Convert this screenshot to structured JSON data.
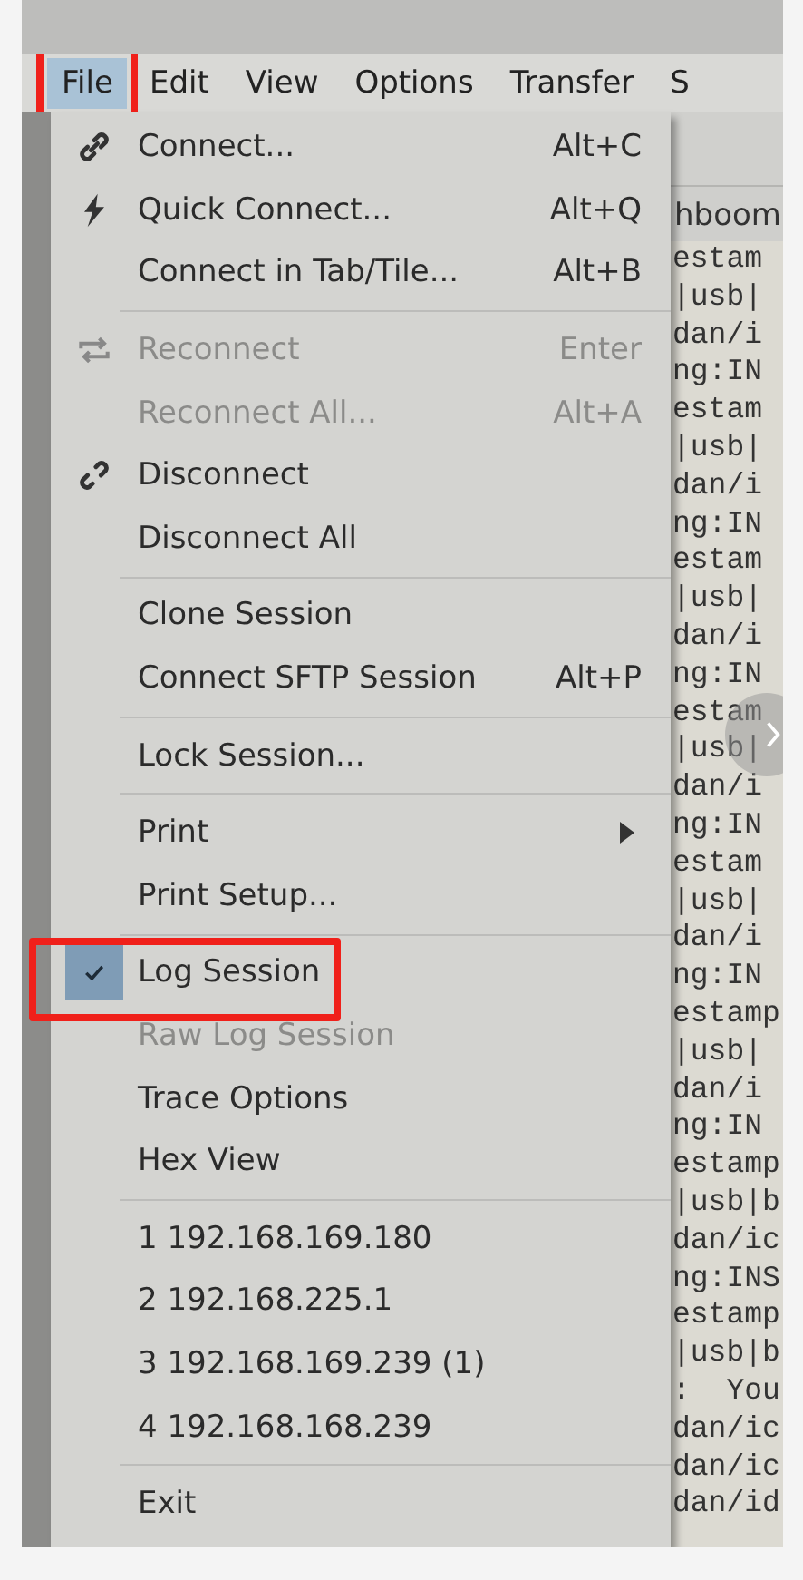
{
  "menubar": [
    {
      "label": "File",
      "selected": true,
      "annotated": true
    },
    {
      "label": "Edit",
      "selected": false,
      "annotated": false
    },
    {
      "label": "View",
      "selected": false,
      "annotated": false
    },
    {
      "label": "Options",
      "selected": false,
      "annotated": false
    },
    {
      "label": "Transfer",
      "selected": false,
      "annotated": false
    },
    {
      "label": "S",
      "selected": false,
      "annotated": false
    }
  ],
  "menu": [
    {
      "kind": "item",
      "label": "Connect...",
      "shortcut": "Alt+C",
      "disabled": false
    },
    {
      "kind": "item",
      "label": "Quick Connect...",
      "shortcut": "Alt+Q",
      "disabled": false
    },
    {
      "kind": "item",
      "label": "Connect in Tab/Tile...",
      "shortcut": "Alt+B",
      "disabled": false
    },
    {
      "kind": "separator"
    },
    {
      "kind": "item",
      "label": "Reconnect",
      "shortcut": "Enter",
      "disabled": true
    },
    {
      "kind": "item",
      "label": "Reconnect All...",
      "shortcut": "Alt+A",
      "disabled": true
    },
    {
      "kind": "item",
      "label": "Disconnect",
      "disabled": false
    },
    {
      "kind": "item",
      "label": "Disconnect All",
      "disabled": false
    },
    {
      "kind": "separator"
    },
    {
      "kind": "item",
      "label": "Clone Session",
      "disabled": false
    },
    {
      "kind": "item",
      "label": "Connect SFTP Session",
      "shortcut": "Alt+P",
      "disabled": false
    },
    {
      "kind": "separator"
    },
    {
      "kind": "item",
      "label": "Lock Session...",
      "disabled": false
    },
    {
      "kind": "separator"
    },
    {
      "kind": "item",
      "label": "Print",
      "disabled": false,
      "submenu": true
    },
    {
      "kind": "item",
      "label": "Print Setup...",
      "disabled": false
    },
    {
      "kind": "separator"
    },
    {
      "kind": "item",
      "label": "Log Session",
      "disabled": false,
      "checked": true,
      "annotated": true
    },
    {
      "kind": "item",
      "label": "Raw Log Session",
      "disabled": true,
      "checked": false
    },
    {
      "kind": "item",
      "label": "Trace Options",
      "disabled": false
    },
    {
      "kind": "item",
      "label": "Hex View",
      "disabled": false
    },
    {
      "kind": "separator"
    },
    {
      "kind": "item",
      "label": "1 192.168.169.180",
      "disabled": false
    },
    {
      "kind": "item",
      "label": "2 192.168.225.1",
      "disabled": false
    },
    {
      "kind": "item",
      "label": "3 192.168.169.239 (1)",
      "disabled": false
    },
    {
      "kind": "item",
      "label": "4 192.168.168.239",
      "disabled": false
    },
    {
      "kind": "separator"
    },
    {
      "kind": "item",
      "label": "Exit",
      "disabled": false
    }
  ],
  "tab": {
    "label": "hboom"
  },
  "terminal_lines": [
    "estam",
    "|usb|",
    "dan/i",
    "ng:IN",
    "estam",
    "|usb|",
    "dan/i",
    "ng:IN",
    "estam",
    "|usb|",
    "dan/i",
    "ng:IN",
    "estam",
    "|usb|",
    "dan/i",
    "ng:IN",
    "estam",
    "|usb|",
    "dan/i",
    "ng:IN",
    "estamp",
    "|usb|",
    "dan/i",
    "ng:IN",
    "estamp",
    "|usb|b",
    "dan/ic",
    "ng:INS",
    "estamp",
    "|usb|b",
    ":  You",
    "dan/ic",
    "dan/ic",
    "dan/id"
  ]
}
